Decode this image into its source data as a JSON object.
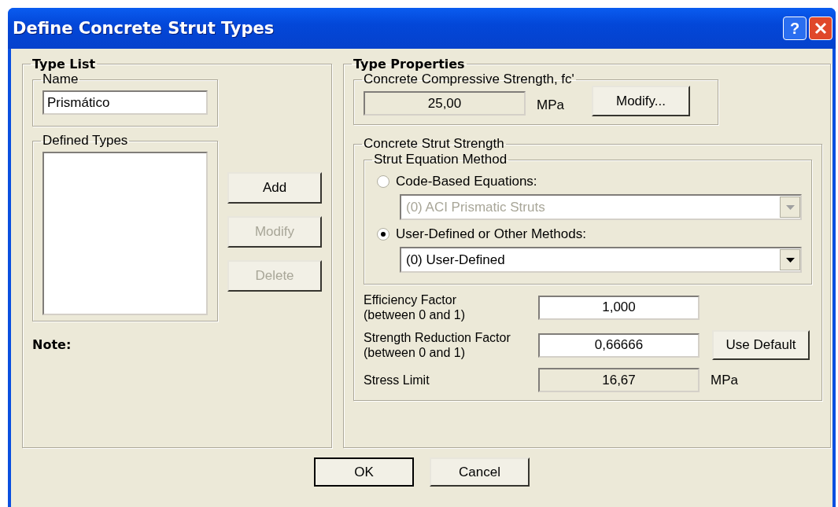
{
  "window": {
    "title": "Define Concrete Strut Types",
    "help": "?"
  },
  "type_list": {
    "title": "Type List",
    "name_group": {
      "label": "Name",
      "value": "Prismático"
    },
    "defined_types": {
      "label": "Defined Types"
    },
    "buttons": [
      {
        "label": "Add",
        "disabled": false
      },
      {
        "label": "Modify",
        "disabled": true
      },
      {
        "label": "Delete",
        "disabled": true
      }
    ],
    "note": "Note:"
  },
  "type_properties": {
    "title": "Type Properties",
    "compressive": {
      "label": "Concrete Compressive Strength, fc'",
      "value": "25,00",
      "unit": "MPa",
      "button": "Modify..."
    },
    "strut_strength": {
      "label": "Concrete Strut Strength",
      "method": {
        "label": "Strut Equation Method",
        "options": [
          {
            "label": "Code-Based Equations:",
            "selected": false,
            "dropdown": "(0) ACI Prismatic Struts"
          },
          {
            "label": "User-Defined or Other Methods:",
            "selected": true,
            "dropdown": "(0) User-Defined"
          }
        ]
      },
      "fields": [
        {
          "kind": "input",
          "label": "Efficiency Factor",
          "sublabel": "(between 0 and 1)",
          "value": "1,000"
        },
        {
          "kind": "input",
          "label": "Strength Reduction Factor",
          "sublabel": "(between 0 and 1)",
          "value": "0,66666",
          "button": "Use Default"
        },
        {
          "kind": "readonly",
          "label": "Stress Limit",
          "value": "16,67",
          "unit": "MPa"
        }
      ]
    }
  },
  "buttons": [
    {
      "label": "OK",
      "default": true
    },
    {
      "label": "Cancel",
      "default": false
    }
  ]
}
